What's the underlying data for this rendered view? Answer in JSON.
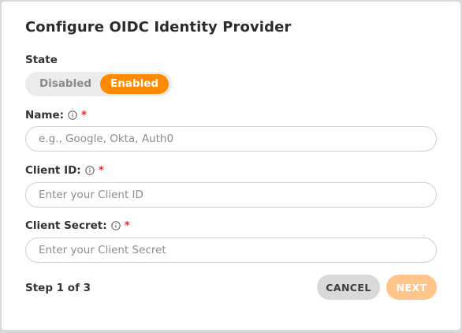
{
  "dialog": {
    "title": "Configure OIDC Identity Provider"
  },
  "state": {
    "label": "State",
    "options": [
      "Disabled",
      "Enabled"
    ],
    "selected": "Enabled"
  },
  "fields": {
    "name": {
      "label": "Name:",
      "required_mark": "*",
      "value": "",
      "placeholder": "e.g., Google, Okta, Auth0"
    },
    "client_id": {
      "label": "Client ID:",
      "required_mark": "*",
      "value": "",
      "placeholder": "Enter your Client ID"
    },
    "client_secret": {
      "label": "Client Secret:",
      "required_mark": "*",
      "value": "",
      "placeholder": "Enter your Client Secret"
    }
  },
  "footer": {
    "step": "Step 1 of 3",
    "cancel_label": "CANCEL",
    "next_label": "NEXT"
  },
  "colors": {
    "accent": "#ff8a00",
    "accent_disabled": "#ffc58a",
    "required": "#e03030"
  },
  "icons": {
    "info": "info-circle-icon"
  }
}
